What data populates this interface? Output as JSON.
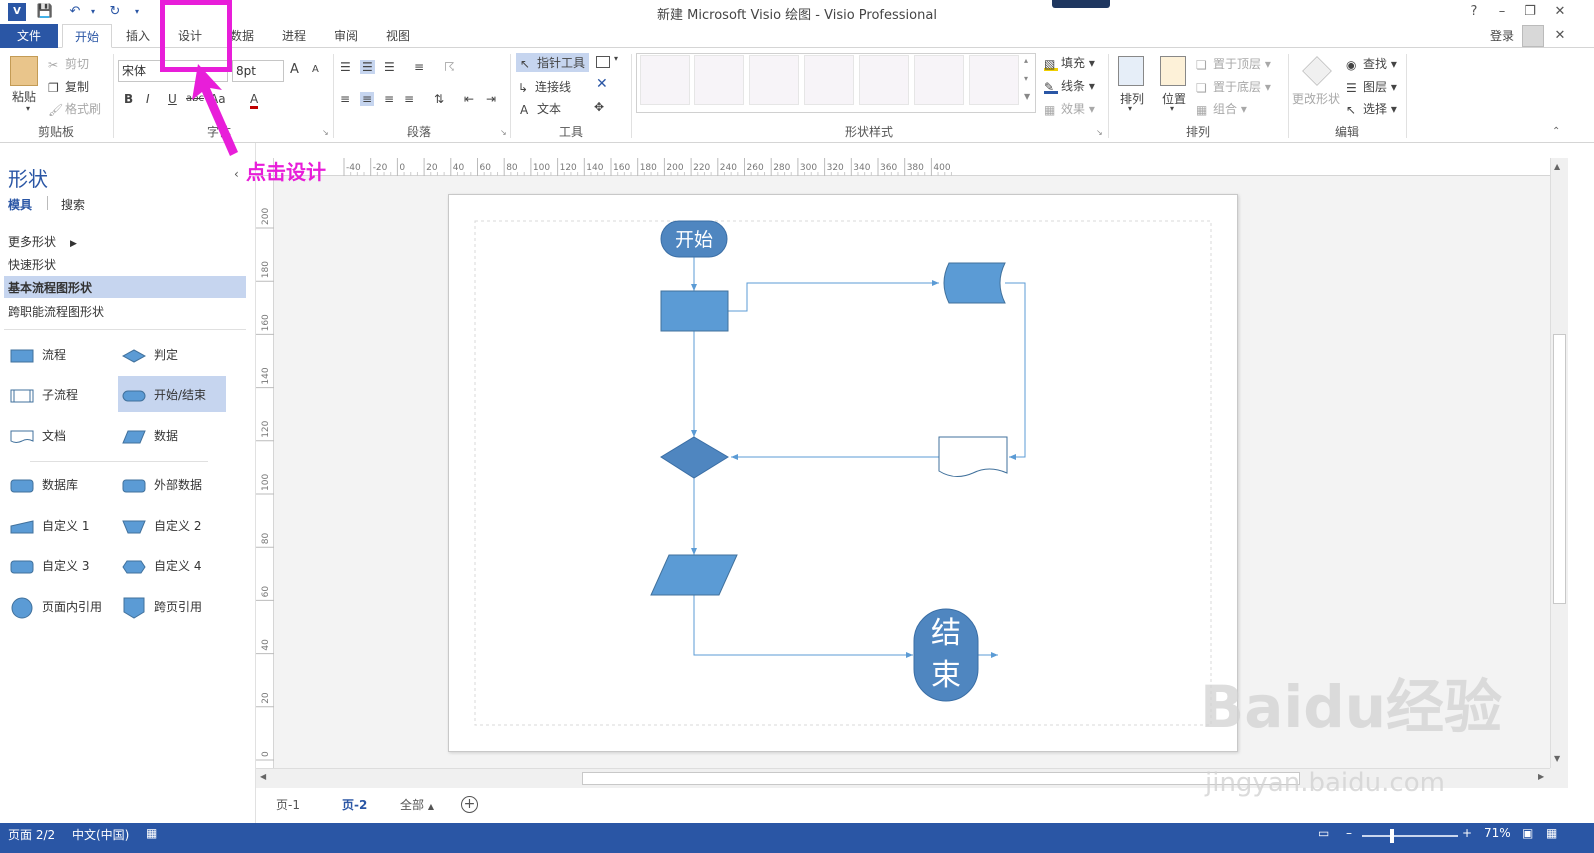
{
  "window": {
    "title": "新建 Microsoft Visio 绘图 - Visio Professional",
    "help": "?",
    "login": "登录"
  },
  "tabs": [
    "文件",
    "开始",
    "插入",
    "设计",
    "数据",
    "进程",
    "审阅",
    "视图"
  ],
  "ribbon": {
    "clipboard": {
      "paste": "粘贴",
      "cut": "剪切",
      "copy": "复制",
      "format_painter": "格式刷",
      "label": "剪贴板"
    },
    "font": {
      "name": "宋体",
      "size": "8pt",
      "bold": "B",
      "italic": "I",
      "underline": "U",
      "strike": "abc",
      "aa": "Aa",
      "color": "A",
      "grow": "A",
      "shrink": "A",
      "label": "字体"
    },
    "paragraph": {
      "label": "段落"
    },
    "tools": {
      "pointer": "指针工具",
      "connector": "连接线",
      "text": "文本",
      "label": "工具"
    },
    "shape_styles": {
      "fill": "填充",
      "line": "线条",
      "effects": "效果",
      "label": "形状样式"
    },
    "arrange": {
      "align": "排列",
      "position": "位置",
      "bring_front": "置于顶层",
      "send_back": "置于底层",
      "group": "组合",
      "label": "排列"
    },
    "editing": {
      "change_shape": "更改形状",
      "find": "查找",
      "layers": "图层",
      "select": "选择",
      "label": "编辑"
    }
  },
  "shapes_pane": {
    "title": "形状",
    "tab_stencils": "模具",
    "tab_search": "搜索",
    "more_shapes": "更多形状",
    "categories": [
      "快速形状",
      "基本流程图形状",
      "跨职能流程图形状"
    ],
    "stencils": [
      [
        "流程",
        "判定"
      ],
      [
        "子流程",
        "开始/结束"
      ],
      [
        "文档",
        "数据"
      ],
      [
        "数据库",
        "外部数据"
      ],
      [
        "自定义 1",
        "自定义 2"
      ],
      [
        "自定义 3",
        "自定义 4"
      ],
      [
        "页面内引用",
        "跨页引用"
      ]
    ]
  },
  "ruler": {
    "h_ticks": [
      "-40",
      "-20",
      "0",
      "20",
      "40",
      "60",
      "80",
      "100",
      "120",
      "140",
      "160",
      "180",
      "200",
      "220",
      "240",
      "260",
      "280",
      "300",
      "320",
      "340",
      "360",
      "380",
      "400"
    ],
    "v_ticks": [
      "200",
      "180",
      "160",
      "140",
      "120",
      "100",
      "80",
      "60",
      "40",
      "20",
      "0"
    ]
  },
  "diagram": {
    "start": "开始",
    "end_1": "结",
    "end_2": "束"
  },
  "page_tabs": {
    "page1": "页-1",
    "page2": "页-2",
    "all": "全部"
  },
  "status": {
    "page": "页面 2/2",
    "lang": "中文(中国)",
    "zoom": "71%"
  },
  "annotation": "点击设计",
  "watermark": {
    "brand": "Baidu经验",
    "url": "jingyan.baidu.com"
  },
  "colors": {
    "accent": "#2a56a5",
    "shape_fill": "#5b9bd5",
    "annotation": "#e81ed9"
  }
}
